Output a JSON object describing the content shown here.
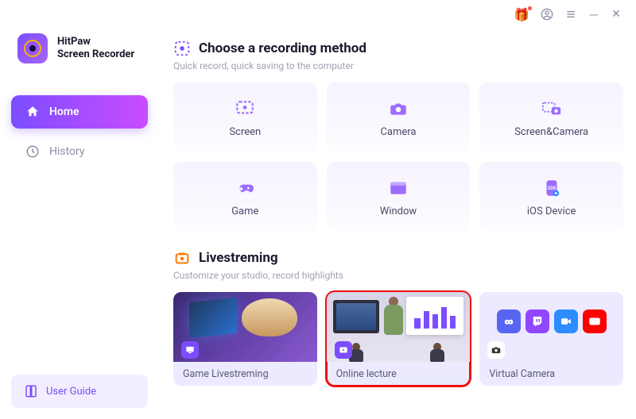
{
  "brand": {
    "line1": "HitPaw",
    "line2": "Screen Recorder"
  },
  "nav": {
    "home": "Home",
    "history": "History"
  },
  "user_guide": "User Guide",
  "recording": {
    "title": "Choose a recording method",
    "subtitle": "Quick record, quick saving to the computer",
    "cards": {
      "screen": "Screen",
      "camera": "Camera",
      "screen_camera": "Screen&Camera",
      "game": "Game",
      "window": "Window",
      "ios": "iOS Device"
    }
  },
  "livestream": {
    "title": "Livestreming",
    "subtitle": "Customize your studio, record highlights",
    "cards": {
      "game": "Game Livestreming",
      "lecture": "Online lecture",
      "virtual": "Virtual Camera"
    }
  }
}
